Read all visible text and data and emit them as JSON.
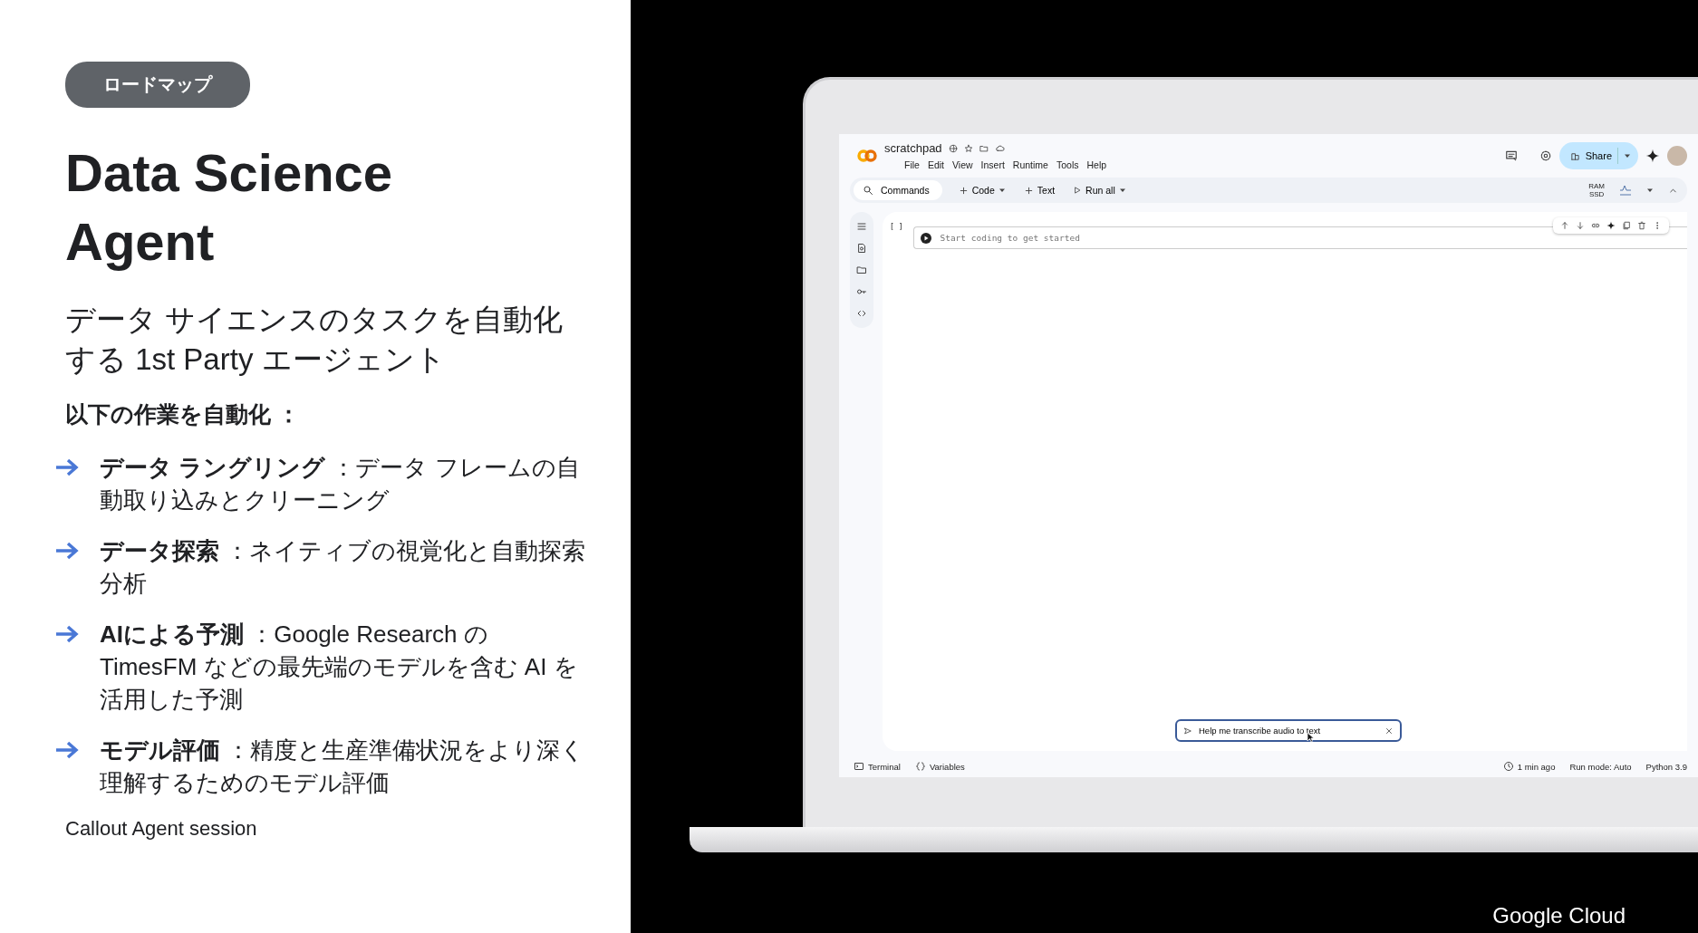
{
  "slide": {
    "tag": "ロードマップ",
    "title": "Data Science Agent",
    "subtitle": "データ サイエンスのタスクを自動化する 1st Party エージェント",
    "intro": "以下の作業を自動化 ：",
    "bullets": [
      {
        "text": "**データ ラングリング** ：データ フレームの自動取り込みとクリーニング"
      },
      {
        "text": "**データ探索** ：ネイティブの視覚化と自動探索分析"
      },
      {
        "text": "**AIによる予測** ：Google Research の TimesFM などの最先端のモデルを含む AI を活用した予測"
      },
      {
        "text": "**モデル評価** ：精度と生産準備状況をより深く理解するためのモデル評価"
      }
    ],
    "note": "Callout Agent session",
    "brand": "Google Cloud"
  },
  "notebook": {
    "name": "scratchpad",
    "menu": [
      "File",
      "Edit",
      "View",
      "Insert",
      "Runtime",
      "Tools",
      "Help"
    ],
    "share": "Share",
    "toolbar": [
      {
        "kind": "search",
        "label": "Commands"
      },
      {
        "kind": "add",
        "label": "Code",
        "dropdown": true
      },
      {
        "kind": "add",
        "label": "Text",
        "dropdown": false
      },
      {
        "kind": "run",
        "label": "Run all",
        "dropdown": true
      }
    ],
    "resources": [
      "RAM",
      "SSD"
    ],
    "cell": {
      "bracket": "[ ]",
      "placeholder": "Start coding to get started"
    },
    "prompt": {
      "value": "Help me transcribe audio to text"
    },
    "status_left": [
      {
        "kind": "terminal",
        "label": "Terminal"
      },
      {
        "kind": "variables",
        "label": "Variables"
      }
    ],
    "status_right": [
      {
        "kind": "clock",
        "label": "1 min ago"
      },
      {
        "kind": "plain",
        "label": "Run mode: Auto"
      },
      {
        "kind": "plain",
        "label": "Python 3.9"
      }
    ]
  }
}
